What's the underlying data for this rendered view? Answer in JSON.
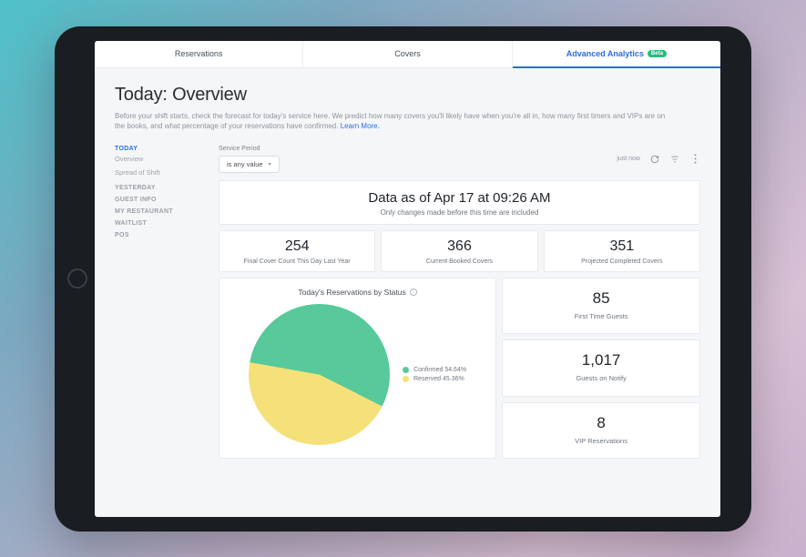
{
  "tabs": [
    {
      "label": "Reservations"
    },
    {
      "label": "Covers"
    },
    {
      "label": "Advanced Analytics",
      "badge": "Beta",
      "active": true
    }
  ],
  "page": {
    "title": "Today: Overview",
    "subtitle": "Before your shift starts, check the forecast for today's service here. We predict how many covers you'll likely have when you're all in, how many first timers and VIPs are on the books, and what percentage of your reservations have confirmed.",
    "learn_more": "Learn More."
  },
  "sidebar": {
    "head": "TODAY",
    "items": [
      {
        "label": "Overview"
      },
      {
        "label": "Spread of Shift"
      }
    ],
    "groups": [
      "YESTERDAY",
      "GUEST INFO",
      "MY RESTAURANT",
      "WAITLIST",
      "POS"
    ]
  },
  "filter": {
    "label": "Service Period",
    "value": "is any value",
    "time": "just now"
  },
  "banner": {
    "title": "Data as of Apr 17 at 09:26 AM",
    "sub": "Only changes made before this time are included"
  },
  "stats_top": [
    {
      "num": "254",
      "lbl": "Final Cover Count This Day Last Year"
    },
    {
      "num": "366",
      "lbl": "Current Booked Covers"
    },
    {
      "num": "351",
      "lbl": "Projected Completed Covers"
    }
  ],
  "pie": {
    "title": "Today's Reservations by Status",
    "legend": [
      {
        "label": "Confirmed 54.64%",
        "color": "#57c99a"
      },
      {
        "label": "Reserved 45.36%",
        "color": "#f5e07a"
      }
    ]
  },
  "stats_side": [
    {
      "num": "85",
      "lbl": "First Time Guests"
    },
    {
      "num": "1,017",
      "lbl": "Guests on Notify"
    },
    {
      "num": "8",
      "lbl": "VIP Reservations"
    }
  ],
  "colors": {
    "accent": "#2a6de0",
    "green": "#57c99a",
    "yellow": "#f5e07a"
  },
  "chart_data": {
    "type": "pie",
    "title": "Today's Reservations by Status",
    "series": [
      {
        "name": "Confirmed",
        "value": 54.64,
        "color": "#57c99a"
      },
      {
        "name": "Reserved",
        "value": 45.36,
        "color": "#f5e07a"
      }
    ]
  }
}
